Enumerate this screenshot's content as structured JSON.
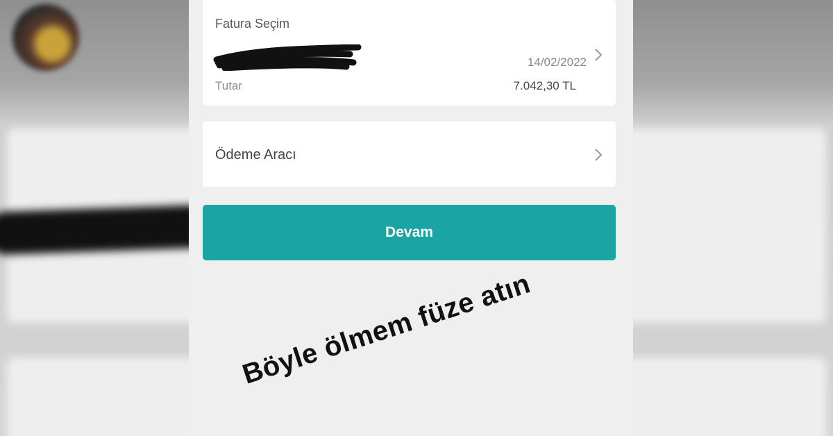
{
  "invoice": {
    "title": "Fatura Seçim",
    "date": "14/02/2022",
    "amount_label": "Tutar",
    "amount": "7.042,30 TL"
  },
  "payment": {
    "label": "Ödeme Aracı"
  },
  "continue_button": "Devam",
  "caption": "Böyle ölmem füze atın",
  "colors": {
    "accent": "#1aa5a3",
    "background": "#efefef",
    "card": "#ffffff"
  },
  "icons": [
    "chevron-right-icon",
    "redaction-scribble"
  ]
}
